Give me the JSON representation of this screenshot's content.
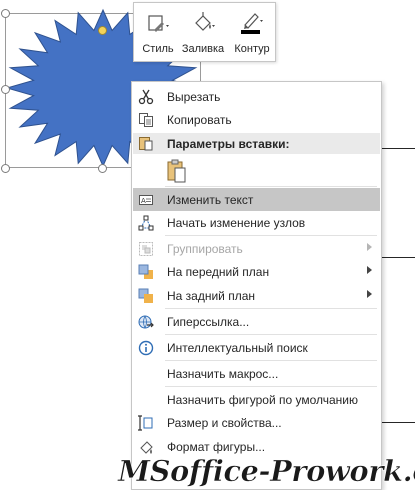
{
  "mini_toolbar": {
    "style_label": "Стиль",
    "fill_label": "Заливка",
    "outline_label": "Контур"
  },
  "context_menu": {
    "cut": "Вырезать",
    "copy": "Копировать",
    "paste_options_header": "Параметры вставки:",
    "edit_text": "Изменить текст",
    "edit_points": "Начать изменение узлов",
    "group": "Группировать",
    "bring_to_front": "На передний план",
    "send_to_back": "На задний план",
    "hyperlink": "Гиперссылка...",
    "smart_lookup": "Интеллектуальный поиск",
    "assign_macro": "Назначить макрос...",
    "set_default_shape": "Назначить фигурой по умолчанию",
    "size_and_properties": "Размер и свойства...",
    "format_shape": "Формат фигуры..."
  },
  "watermark": "MSoffice-Prowork.com",
  "colors": {
    "shape_fill": "#4472c4",
    "shape_stroke": "#2f528f",
    "highlight": "#c6c6c6",
    "watermark": "#1a1a1a"
  }
}
